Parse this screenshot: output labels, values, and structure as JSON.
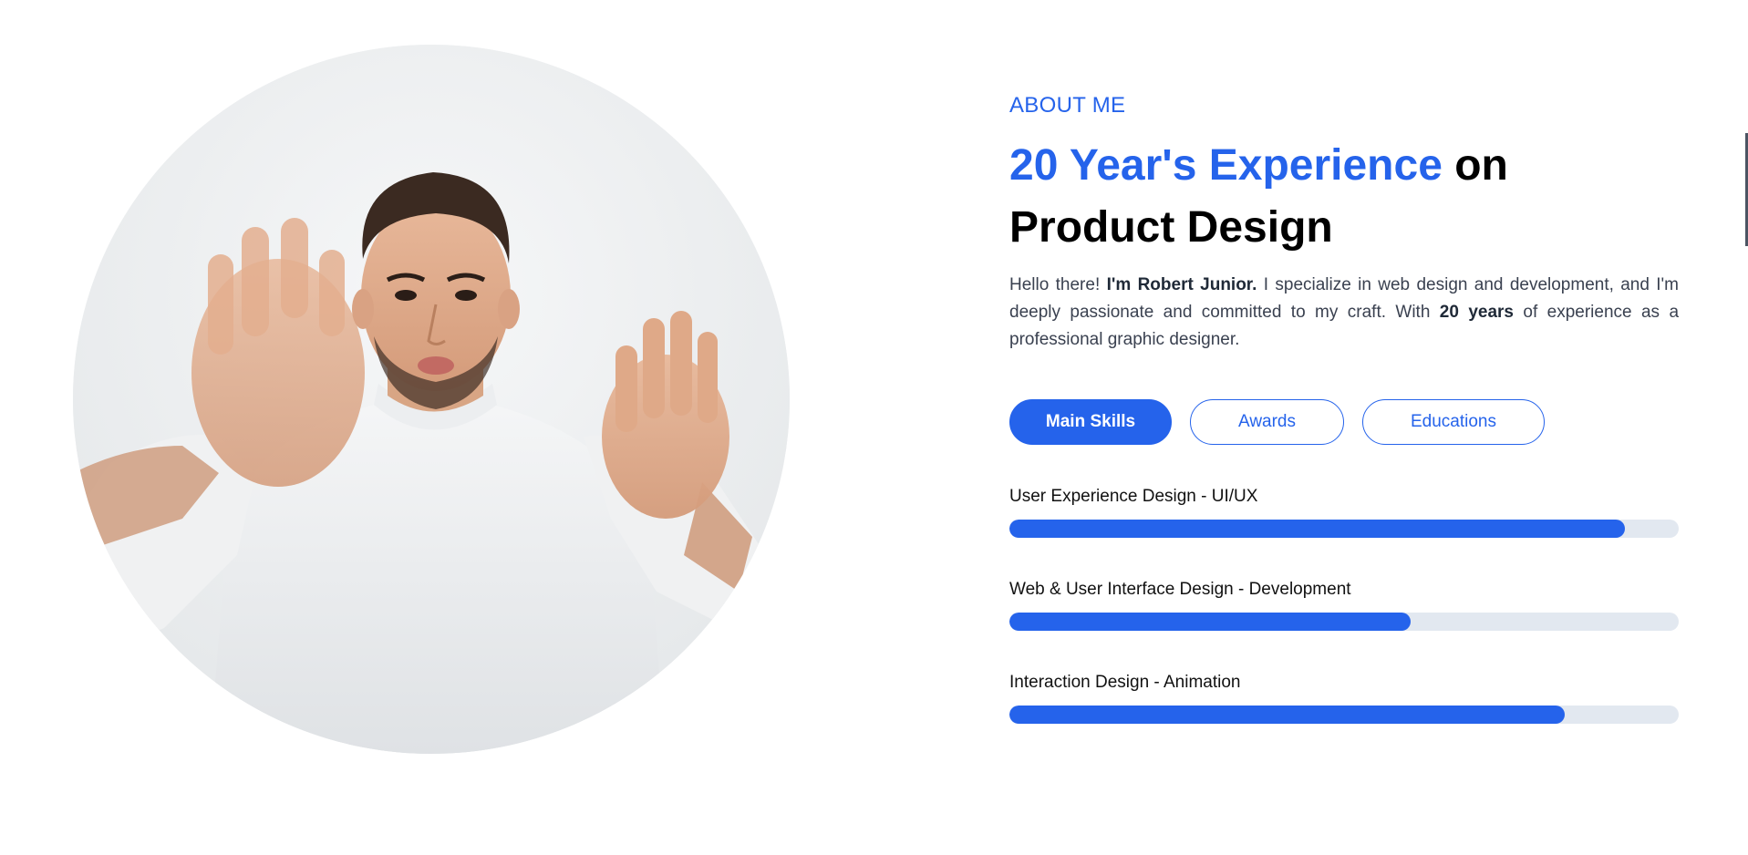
{
  "about": {
    "eyebrow": "ABOUT ME",
    "headline_accent": "20 Year's Experience",
    "headline_rest_1": "on",
    "headline_rest_2": "Product Design",
    "bio": {
      "part1": "Hello there! ",
      "name_bold": "I'm Robert Junior.",
      "part2": " I specialize in web design and development, and I'm deeply passionate and committed to my craft. With ",
      "years_bold": "20 years",
      "part3": " of experience as a professional graphic designer."
    }
  },
  "tabs": [
    {
      "label": "Main Skills",
      "active": true
    },
    {
      "label": "Awards",
      "active": false
    },
    {
      "label": "Educations",
      "active": false
    }
  ],
  "skills": [
    {
      "label": "User Experience Design - UI/UX",
      "percent": 92
    },
    {
      "label": "Web & User Interface Design - Development",
      "percent": 60
    },
    {
      "label": "Interaction Design - Animation",
      "percent": 83
    }
  ],
  "colors": {
    "accent": "#2563eb",
    "track": "#e2e8f0"
  },
  "icons": {
    "portrait": "portrait-photo"
  }
}
